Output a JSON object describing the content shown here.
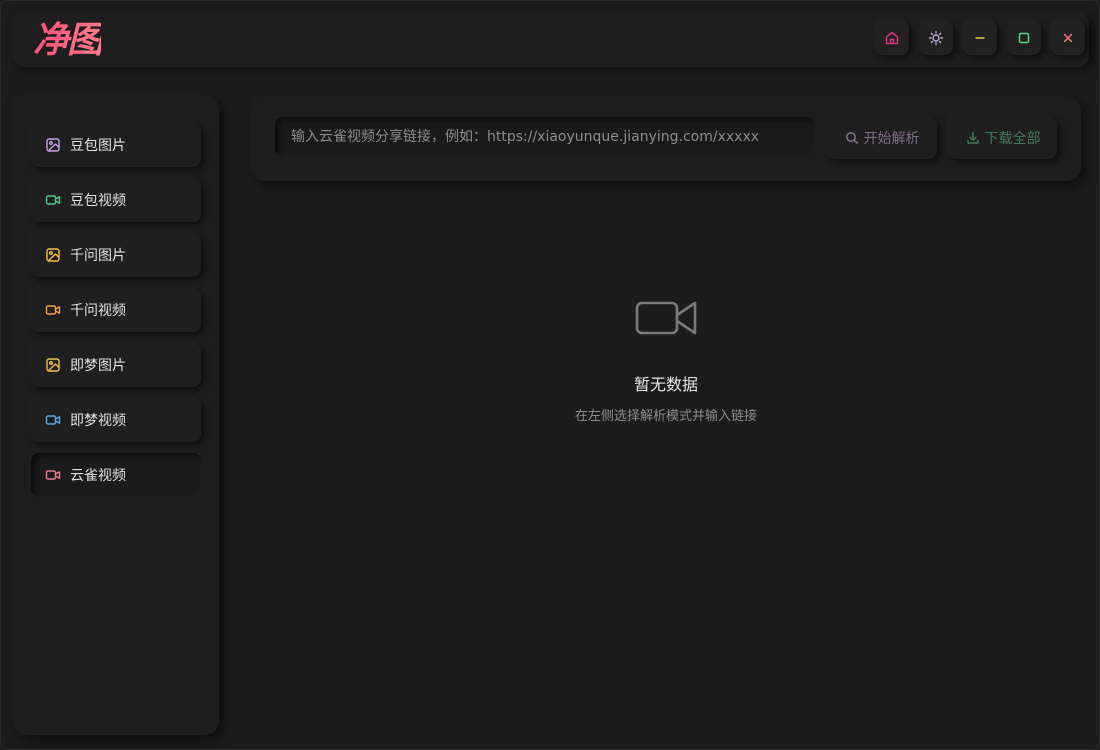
{
  "app": {
    "logo_text": "净图"
  },
  "window_buttons": [
    {
      "name": "home-button",
      "icon": "home-icon",
      "color": "#e0307a"
    },
    {
      "name": "theme-toggle-button",
      "icon": "sun-icon",
      "color": "#b8a8d8"
    },
    {
      "name": "minimize-button",
      "icon": "minimize-icon",
      "color": "#e8c94a"
    },
    {
      "name": "maximize-button",
      "icon": "maximize-icon",
      "color": "#56d38a"
    },
    {
      "name": "close-button",
      "icon": "close-icon",
      "color": "#f07a7a"
    }
  ],
  "sidebar": {
    "items": [
      {
        "label": "豆包图片",
        "icon": "image-icon",
        "color": "#c8a2e0",
        "active": false
      },
      {
        "label": "豆包视频",
        "icon": "video-icon",
        "color": "#4ad08a",
        "active": false
      },
      {
        "label": "千问图片",
        "icon": "image-icon",
        "color": "#f0c048",
        "active": false
      },
      {
        "label": "千问视频",
        "icon": "video-icon",
        "color": "#f0a050",
        "active": false
      },
      {
        "label": "即梦图片",
        "icon": "image-icon",
        "color": "#f0c048",
        "active": false
      },
      {
        "label": "即梦视频",
        "icon": "video-icon",
        "color": "#5aa8e8",
        "active": false
      },
      {
        "label": "云雀视频",
        "icon": "video-icon",
        "color": "#f07890",
        "active": true
      }
    ]
  },
  "search": {
    "placeholder": "输入云雀视频分享链接，例如：https://xiaoyunque.jianying.com/xxxxx",
    "value": ""
  },
  "actions": {
    "parse_label": "开始解析",
    "download_label": "下载全部"
  },
  "empty_state": {
    "title": "暂无数据",
    "subtitle": "在左侧选择解析模式并输入链接"
  }
}
